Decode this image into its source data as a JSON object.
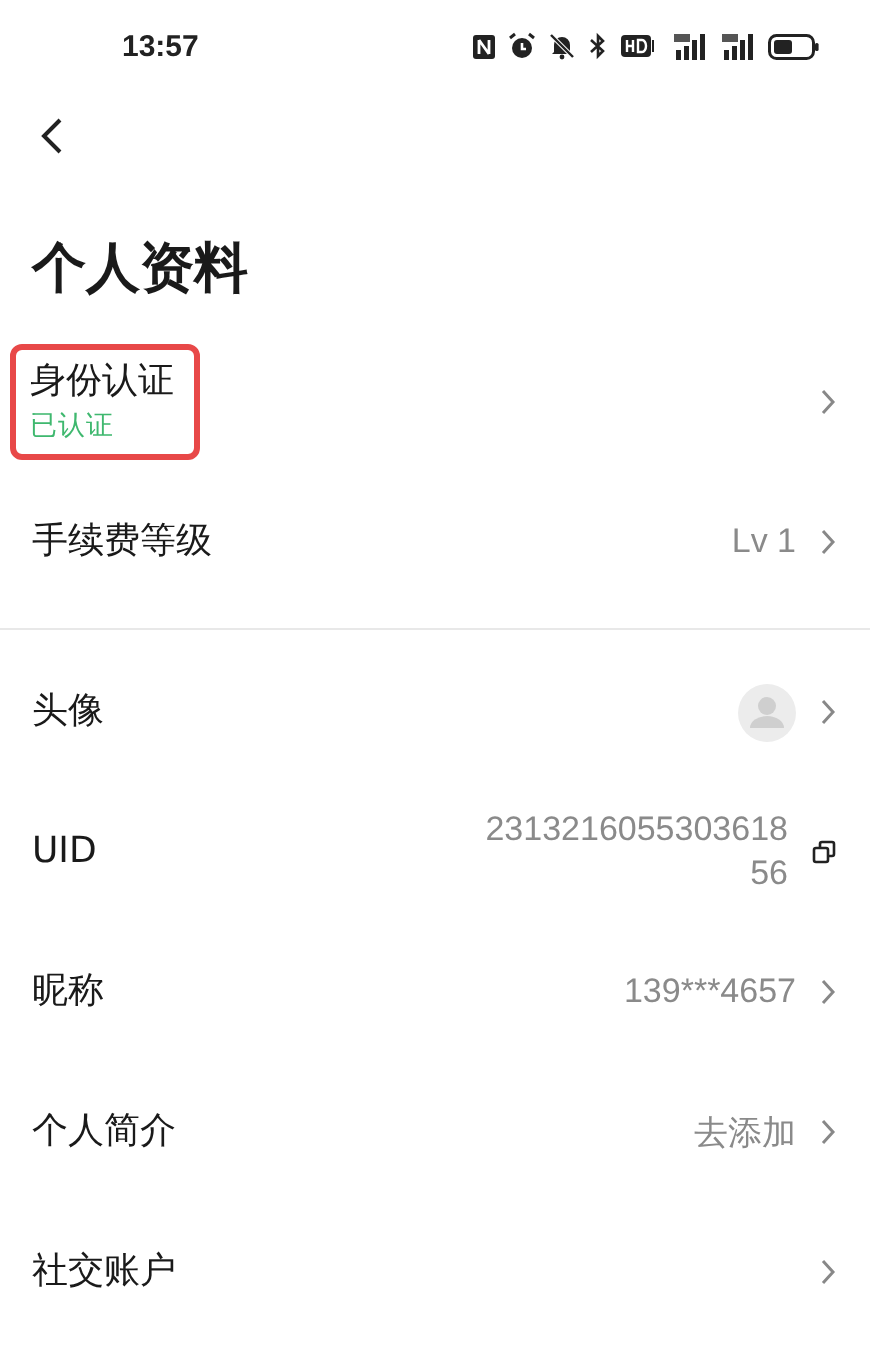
{
  "status_bar": {
    "time": "13:57"
  },
  "page": {
    "title": "个人资料"
  },
  "sections": [
    {
      "items": [
        {
          "kind": "status",
          "label": "身份认证",
          "status": "已认证",
          "highlighted": true
        },
        {
          "kind": "value",
          "label": "手续费等级",
          "value": "Lv 1"
        }
      ]
    },
    {
      "items": [
        {
          "kind": "avatar",
          "label": "头像"
        },
        {
          "kind": "copy",
          "label": "UID",
          "value": "231321605530361856"
        },
        {
          "kind": "value",
          "label": "昵称",
          "value": "139***4657"
        },
        {
          "kind": "value",
          "label": "个人简介",
          "value": "去添加"
        },
        {
          "kind": "value",
          "label": "社交账户"
        }
      ]
    }
  ]
}
